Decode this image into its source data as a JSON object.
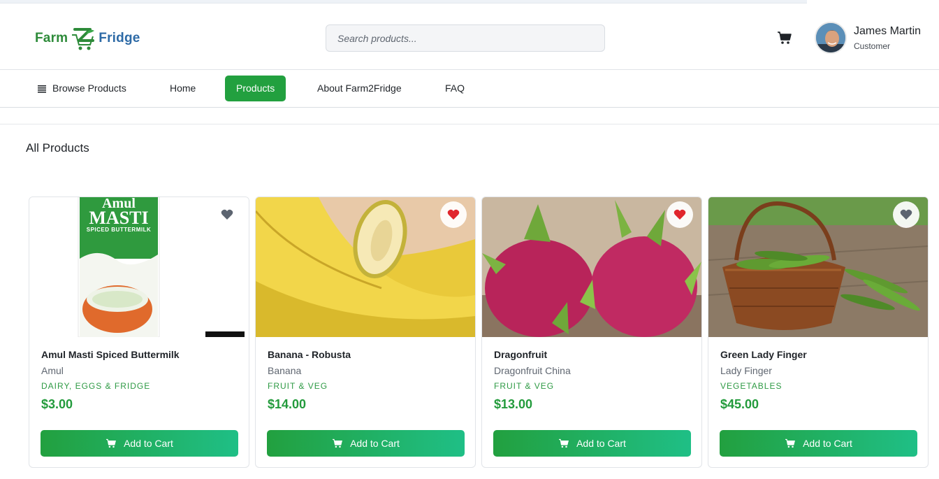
{
  "app": {
    "logo_part1": "Farm",
    "logo_part2": "Fridge",
    "brand_color": "#22a03f"
  },
  "header": {
    "search_placeholder": "Search products...",
    "cart_icon": "cart-icon",
    "user": {
      "name": "James Martin",
      "role": "Customer"
    }
  },
  "nav": {
    "browse_label": "Browse Products",
    "items": [
      {
        "label": "Home",
        "active": false
      },
      {
        "label": "Products",
        "active": true
      },
      {
        "label": "About Farm2Fridge",
        "active": false
      },
      {
        "label": "FAQ",
        "active": false
      }
    ]
  },
  "main": {
    "title": "All Products",
    "add_label": "Add to Cart",
    "products": [
      {
        "name": "Amul Masti Spiced Buttermilk",
        "brand": "Amul",
        "category": "DAIRY, EGGS & FRIDGE",
        "price": "$3.00",
        "favorite": false
      },
      {
        "name": "Banana - Robusta",
        "brand": "Banana",
        "category": "FRUIT & VEG",
        "price": "$14.00",
        "favorite": true
      },
      {
        "name": "Dragonfruit",
        "brand": "Dragonfruit China",
        "category": "FRUIT & VEG",
        "price": "$13.00",
        "favorite": true
      },
      {
        "name": "Green Lady Finger",
        "brand": "Lady Finger",
        "category": "VEGETABLES",
        "price": "$45.00",
        "favorite": false
      }
    ]
  },
  "package_text": {
    "line1": "Amul",
    "line2": "MASTI",
    "line3": "SPICED BUTTERMILK"
  }
}
